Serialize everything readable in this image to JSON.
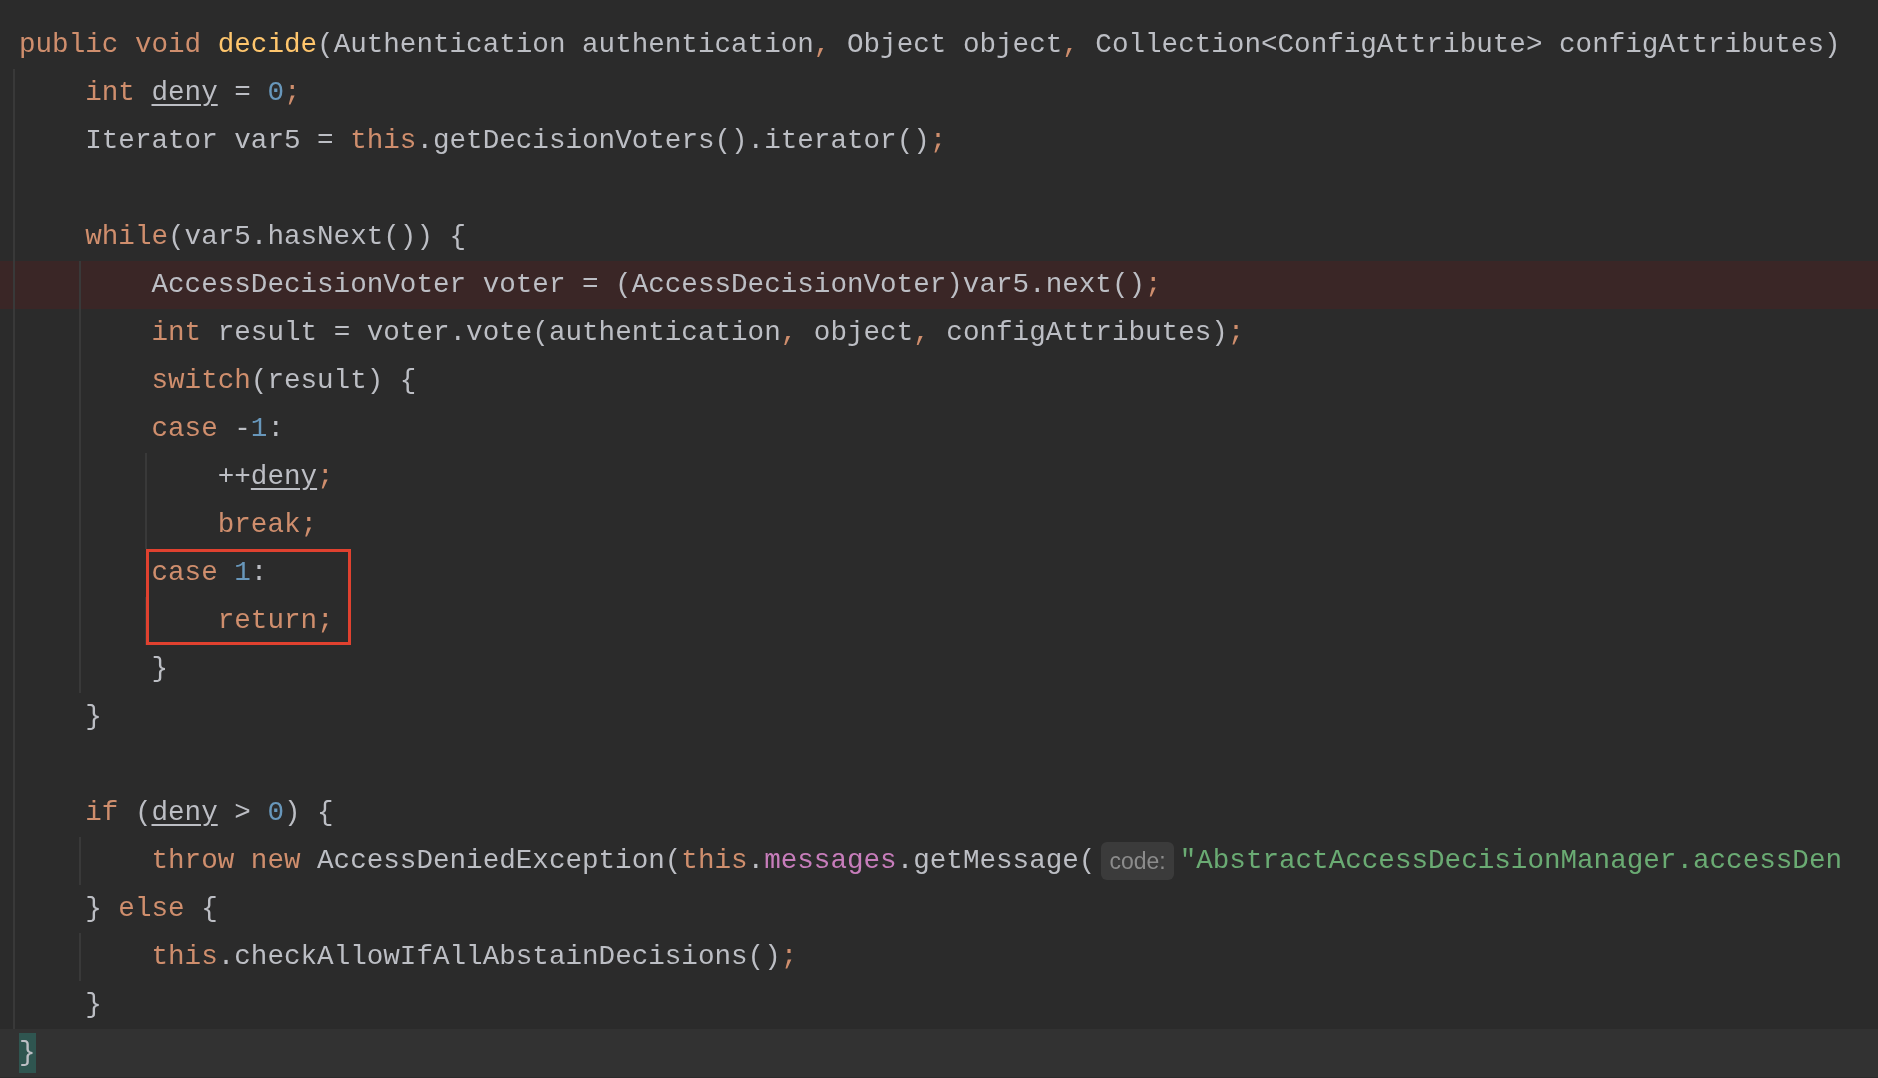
{
  "editor": {
    "lines": [
      {
        "highlighted": false,
        "boxed": false,
        "current": false,
        "tokens": [
          {
            "kind": "keyword",
            "text": "public void "
          },
          {
            "kind": "declaration",
            "text": "decide"
          },
          {
            "kind": "plain",
            "text": "(Authentication authentication"
          },
          {
            "kind": "punct",
            "text": ","
          },
          {
            "kind": "plain",
            "text": " Object object"
          },
          {
            "kind": "punct",
            "text": ","
          },
          {
            "kind": "plain",
            "text": " Collection<ConfigAttribute> configAttributes)"
          }
        ],
        "children": [
          {
            "highlighted": false,
            "boxed": false,
            "current": false,
            "tokens": [
              {
                "kind": "keyword",
                "text": "int "
              },
              {
                "kind": "variable",
                "text": "deny"
              },
              {
                "kind": "plain",
                "text": " = "
              },
              {
                "kind": "number",
                "text": "0"
              },
              {
                "kind": "punct",
                "text": ";"
              }
            ]
          },
          {
            "highlighted": false,
            "boxed": false,
            "current": false,
            "tokens": [
              {
                "kind": "plain",
                "text": "Iterator var5 = "
              },
              {
                "kind": "keyword",
                "text": "this"
              },
              {
                "kind": "plain",
                "text": ".getDecisionVoters().iterator()"
              },
              {
                "kind": "punct",
                "text": ";"
              }
            ]
          },
          {
            "highlighted": false,
            "boxed": false,
            "current": false
          },
          {
            "highlighted": false,
            "boxed": false,
            "current": false,
            "tokens": [
              {
                "kind": "keyword",
                "text": "while"
              },
              {
                "kind": "plain",
                "text": "(var5.hasNext()) {"
              }
            ],
            "children": [
              {
                "highlighted": true,
                "boxed": false,
                "current": false,
                "tokens": [
                  {
                    "kind": "plain",
                    "text": "AccessDecisionVoter voter = (AccessDecisionVoter)var5.next()"
                  },
                  {
                    "kind": "punct",
                    "text": ";"
                  }
                ]
              },
              {
                "highlighted": false,
                "boxed": false,
                "current": false,
                "tokens": [
                  {
                    "kind": "keyword",
                    "text": "int "
                  },
                  {
                    "kind": "plain",
                    "text": "result = voter.vote(authentication"
                  },
                  {
                    "kind": "punct",
                    "text": ","
                  },
                  {
                    "kind": "plain",
                    "text": " object"
                  },
                  {
                    "kind": "punct",
                    "text": ","
                  },
                  {
                    "kind": "plain",
                    "text": " configAttributes)"
                  },
                  {
                    "kind": "punct",
                    "text": ";"
                  }
                ]
              },
              {
                "highlighted": false,
                "boxed": false,
                "current": false,
                "tokens": [
                  {
                    "kind": "keyword",
                    "text": "switch"
                  },
                  {
                    "kind": "plain",
                    "text": "(result) {"
                  }
                ]
              },
              {
                "highlighted": false,
                "boxed": false,
                "current": false,
                "tokens": [
                  {
                    "kind": "keyword",
                    "text": "case "
                  },
                  {
                    "kind": "plain",
                    "text": "-"
                  },
                  {
                    "kind": "number",
                    "text": "1"
                  },
                  {
                    "kind": "plain",
                    "text": ":"
                  }
                ],
                "children": [
                  {
                    "highlighted": false,
                    "boxed": false,
                    "current": false,
                    "tokens": [
                      {
                        "kind": "plain",
                        "text": "++"
                      },
                      {
                        "kind": "variable",
                        "text": "deny"
                      },
                      {
                        "kind": "punct",
                        "text": ";"
                      }
                    ]
                  },
                  {
                    "highlighted": false,
                    "boxed": false,
                    "current": false,
                    "tokens": [
                      {
                        "kind": "keyword",
                        "text": "break;"
                      }
                    ]
                  }
                ]
              },
              {
                "highlighted": false,
                "boxed": true,
                "current": false,
                "tokens": [
                  {
                    "kind": "keyword",
                    "text": "case "
                  },
                  {
                    "kind": "number",
                    "text": "1"
                  },
                  {
                    "kind": "plain",
                    "text": ":"
                  }
                ],
                "children": [
                  {
                    "highlighted": false,
                    "boxed": true,
                    "current": false,
                    "tokens": [
                      {
                        "kind": "keyword",
                        "text": "return;"
                      }
                    ]
                  }
                ]
              },
              {
                "highlighted": false,
                "boxed": false,
                "current": false,
                "tokens": [
                  {
                    "kind": "plain",
                    "text": "}"
                  }
                ]
              }
            ]
          },
          {
            "highlighted": false,
            "boxed": false,
            "current": false,
            "tokens": [
              {
                "kind": "plain",
                "text": "}"
              }
            ]
          },
          {
            "highlighted": false,
            "boxed": false,
            "current": false
          },
          {
            "highlighted": false,
            "boxed": false,
            "current": false,
            "tokens": [
              {
                "kind": "keyword",
                "text": "if "
              },
              {
                "kind": "plain",
                "text": "("
              },
              {
                "kind": "variable",
                "text": "deny"
              },
              {
                "kind": "plain",
                "text": " > "
              },
              {
                "kind": "number",
                "text": "0"
              },
              {
                "kind": "plain",
                "text": ") {"
              }
            ],
            "children": [
              {
                "highlighted": false,
                "boxed": false,
                "current": false,
                "tokens": [
                  {
                    "kind": "keyword",
                    "text": "throw new "
                  },
                  {
                    "kind": "plain",
                    "text": "AccessDeniedException("
                  },
                  {
                    "kind": "keyword",
                    "text": "this"
                  },
                  {
                    "kind": "plain",
                    "text": "."
                  },
                  {
                    "kind": "field",
                    "text": "messages"
                  },
                  {
                    "kind": "plain",
                    "text": ".getMessage("
                  },
                  {
                    "kind": "hint",
                    "text": "code:"
                  },
                  {
                    "kind": "string",
                    "text": "\"AbstractAccessDecisionManager.accessDen"
                  }
                ]
              }
            ]
          },
          {
            "highlighted": false,
            "boxed": false,
            "current": false,
            "tokens": [
              {
                "kind": "plain",
                "text": "} "
              },
              {
                "kind": "keyword",
                "text": "else "
              },
              {
                "kind": "plain",
                "text": "{"
              }
            ],
            "children": [
              {
                "highlighted": false,
                "boxed": false,
                "current": false,
                "tokens": [
                  {
                    "kind": "keyword",
                    "text": "this"
                  },
                  {
                    "kind": "plain",
                    "text": ".checkAllowIfAllAbstainDecisions()"
                  },
                  {
                    "kind": "punct",
                    "text": ";"
                  }
                ]
              }
            ]
          },
          {
            "highlighted": false,
            "boxed": false,
            "current": false,
            "tokens": [
              {
                "kind": "plain",
                "text": "}"
              }
            ]
          }
        ]
      },
      {
        "highlighted": false,
        "boxed": false,
        "current": true,
        "tokens": [
          {
            "kind": "brace",
            "text": "}"
          }
        ]
      }
    ]
  }
}
